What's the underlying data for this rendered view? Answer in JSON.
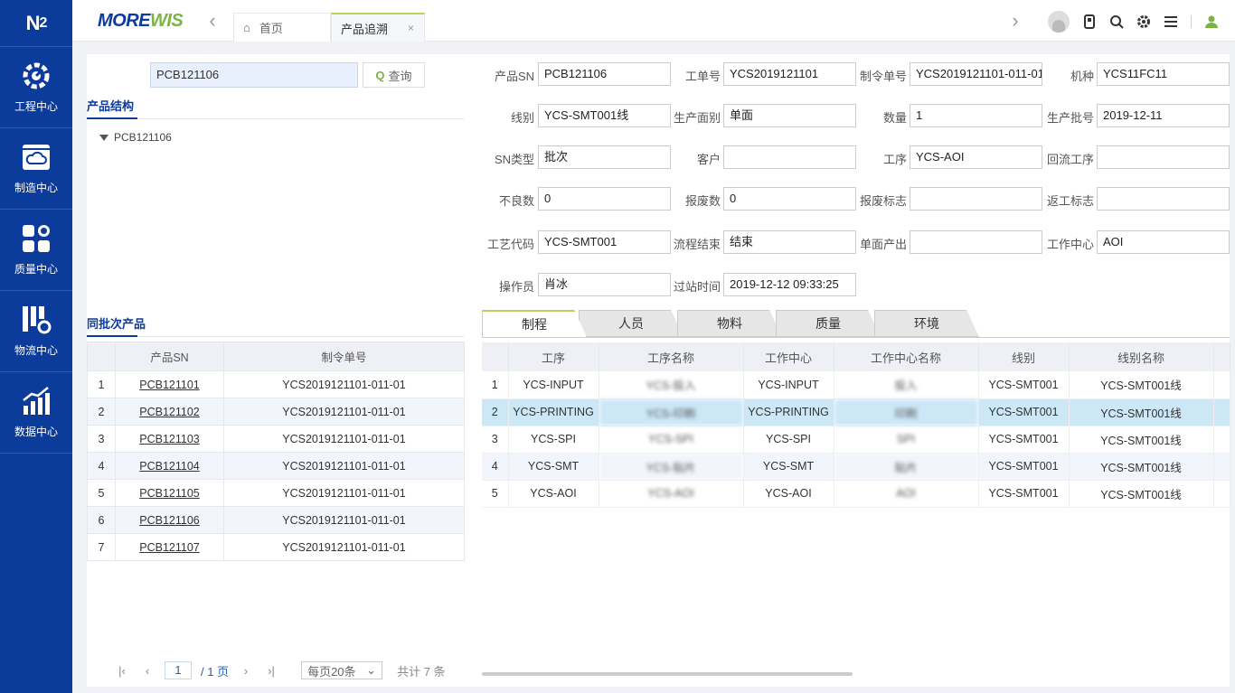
{
  "sidebar": {
    "logo": "N",
    "logo_sub": "2",
    "items": [
      {
        "label": "工程中心",
        "icon": "gear-icon"
      },
      {
        "label": "制造中心",
        "icon": "cloud-icon"
      },
      {
        "label": "质量中心",
        "icon": "apps-icon"
      },
      {
        "label": "物流中心",
        "icon": "logistics-icon"
      },
      {
        "label": "数据中心",
        "icon": "bar-chart-icon"
      }
    ]
  },
  "header": {
    "brand_main": "MORE",
    "brand_accent": "WIS",
    "tabs": [
      {
        "label": "首页",
        "icon": "home-icon"
      },
      {
        "label": "产品追溯",
        "close": "×"
      }
    ]
  },
  "search": {
    "value": "PCB121106",
    "button_label": "查询"
  },
  "structure": {
    "title": "产品结构",
    "node": "PCB121106"
  },
  "batch": {
    "title": "同批次产品",
    "columns": [
      "",
      "产品SN",
      "制令单号"
    ],
    "rows": [
      {
        "no": "1",
        "sn": "PCB121101",
        "order": "YCS2019121101-011-01"
      },
      {
        "no": "2",
        "sn": "PCB121102",
        "order": "YCS2019121101-011-01"
      },
      {
        "no": "3",
        "sn": "PCB121103",
        "order": "YCS2019121101-011-01"
      },
      {
        "no": "4",
        "sn": "PCB121104",
        "order": "YCS2019121101-011-01"
      },
      {
        "no": "5",
        "sn": "PCB121105",
        "order": "YCS2019121101-011-01"
      },
      {
        "no": "6",
        "sn": "PCB121106",
        "order": "YCS2019121101-011-01"
      },
      {
        "no": "7",
        "sn": "PCB121107",
        "order": "YCS2019121101-011-01"
      }
    ]
  },
  "pager": {
    "page": "1",
    "total_pages": "/ 1 页",
    "page_size": "每页20条",
    "total": "共计 7 条"
  },
  "form": {
    "rows": [
      [
        {
          "label": "产品SN",
          "value": "PCB121106"
        },
        {
          "label": "工单号",
          "value": "YCS2019121101"
        },
        {
          "label": "制令单号",
          "value": "YCS2019121101-011-01"
        },
        {
          "label": "机种",
          "value": "YCS11FC11"
        }
      ],
      [
        {
          "label": "线别",
          "value": "YCS-SMT001线"
        },
        {
          "label": "生产面别",
          "value": "单面"
        },
        {
          "label": "数量",
          "value": "1"
        },
        {
          "label": "生产批号",
          "value": "2019-12-11"
        }
      ],
      [
        {
          "label": "SN类型",
          "value": "批次"
        },
        {
          "label": "客户",
          "value": ""
        },
        {
          "label": "工序",
          "value": "YCS-AOI"
        },
        {
          "label": "回流工序",
          "value": ""
        }
      ],
      [
        {
          "label": "不良数",
          "value": "0"
        },
        {
          "label": "报废数",
          "value": "0"
        },
        {
          "label": "报废标志",
          "value": ""
        },
        {
          "label": "返工标志",
          "value": ""
        }
      ],
      [
        {
          "label": "工艺代码",
          "value": "YCS-SMT001"
        },
        {
          "label": "流程结束",
          "value": "结束"
        },
        {
          "label": "单面产出",
          "value": ""
        },
        {
          "label": "工作中心",
          "value": "AOI"
        }
      ],
      [
        {
          "label": "操作员",
          "value": "肖冰"
        },
        {
          "label": "过站时间",
          "value": "2019-12-12 09:33:25"
        }
      ]
    ]
  },
  "detail_tabs": [
    "制程",
    "人员",
    "物料",
    "质量",
    "环境"
  ],
  "process": {
    "columns": [
      "",
      "工序",
      "工序名称",
      "工作中心",
      "工作中心名称",
      "线别",
      "线别名称"
    ],
    "rows": [
      {
        "no": "1",
        "op": "YCS-INPUT",
        "op_name": "YCS-投入",
        "wc": "YCS-INPUT",
        "wc_name": "投入",
        "line": "YCS-SMT001",
        "line_name": "YCS-SMT001线"
      },
      {
        "no": "2",
        "op": "YCS-PRINTING",
        "op_name": "YCS-印刷",
        "wc": "YCS-PRINTING",
        "wc_name": "印刷",
        "line": "YCS-SMT001",
        "line_name": "YCS-SMT001线"
      },
      {
        "no": "3",
        "op": "YCS-SPI",
        "op_name": "YCS-SPI",
        "wc": "YCS-SPI",
        "wc_name": "SPI",
        "line": "YCS-SMT001",
        "line_name": "YCS-SMT001线"
      },
      {
        "no": "4",
        "op": "YCS-SMT",
        "op_name": "YCS-贴片",
        "wc": "YCS-SMT",
        "wc_name": "贴片",
        "line": "YCS-SMT001",
        "line_name": "YCS-SMT001线"
      },
      {
        "no": "5",
        "op": "YCS-AOI",
        "op_name": "YCS-AOI",
        "wc": "YCS-AOI",
        "wc_name": "AOI",
        "line": "YCS-SMT001",
        "line_name": "YCS-SMT001线"
      }
    ]
  },
  "colors": {
    "sidebar": "#0b3c9c",
    "accent": "#7cb342",
    "selected_row": "#cce8f7"
  }
}
